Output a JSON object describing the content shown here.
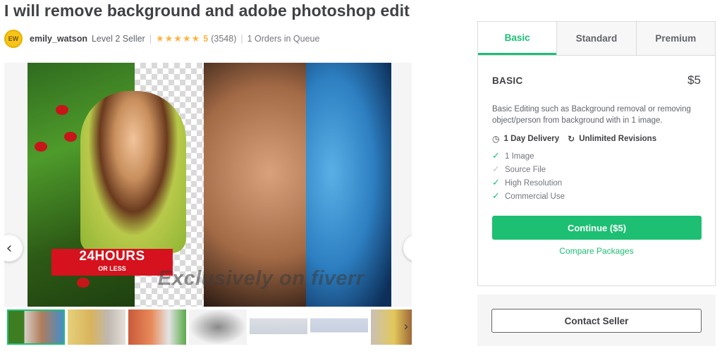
{
  "gig": {
    "title": "I will remove background and adobe photoshop edit"
  },
  "seller": {
    "avatar_initials": "EW",
    "name": "emily_watson",
    "level": "Level 2 Seller",
    "separator": "|",
    "stars": "★★★★★",
    "rating": "5",
    "review_count": "(3548)",
    "queue": "1 Orders in Queue"
  },
  "gallery": {
    "badge_big": "24HOURS",
    "badge_small": "OR LESS",
    "watermark": "Exclusively on fiverr",
    "prev_icon": "chevron-left-icon",
    "next_icon": "chevron-right-icon",
    "prev_glyph": "‹",
    "next_glyph": "›",
    "thumbnail_count": 7
  },
  "package": {
    "tabs": [
      {
        "label": "Basic",
        "active": true
      },
      {
        "label": "Standard",
        "active": false
      },
      {
        "label": "Premium",
        "active": false
      }
    ],
    "name": "BASIC",
    "price": "$5",
    "description": "Basic Editing such as Background removal or removing object/person from background with in 1 image.",
    "delivery_icon": "clock-icon",
    "delivery": "1 Day Delivery",
    "revisions_icon": "refresh-icon",
    "revisions": "Unlimited Revisions",
    "features": [
      {
        "label": "1 Image",
        "included": true
      },
      {
        "label": "Source File",
        "included": false
      },
      {
        "label": "High Resolution",
        "included": true
      },
      {
        "label": "Commercial Use",
        "included": true
      }
    ],
    "continue_label": "Continue ($5)",
    "compare_label": "Compare Packages"
  },
  "contact": {
    "button_label": "Contact Seller"
  },
  "colors": {
    "accent": "#1dbf73",
    "star": "#ffb33e",
    "text": "#404145",
    "muted": "#74767e"
  }
}
